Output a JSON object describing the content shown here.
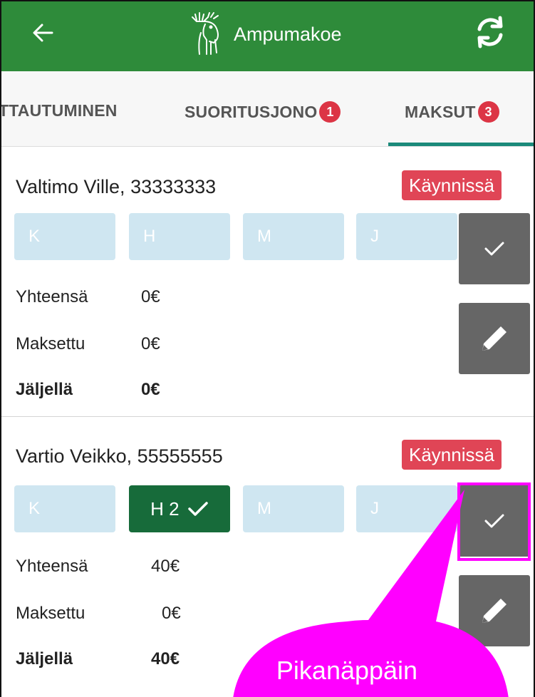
{
  "header": {
    "title": "Ampumakoe"
  },
  "tabs": [
    {
      "label": "TTAUTUMINEN"
    },
    {
      "label": "SUORITUSJONO",
      "badge": "1"
    },
    {
      "label": "MAKSUT",
      "badge": "3"
    }
  ],
  "cards": [
    {
      "name": "Valtimo Ville, 33333333",
      "status": "Käynnissä",
      "chips": [
        "K",
        "H",
        "M",
        "J"
      ],
      "rows": [
        {
          "label": "Yhteensä",
          "value": "0€"
        },
        {
          "label": "Maksettu",
          "value": "0€"
        },
        {
          "label": "Jäljellä",
          "value": "0€"
        }
      ]
    },
    {
      "name": "Vartio Veikko, 55555555",
      "status": "Käynnissä",
      "chips": [
        "K",
        "H 2",
        "M",
        "J"
      ],
      "rows": [
        {
          "label": "Yhteensä",
          "value": "40€"
        },
        {
          "label": "Maksettu",
          "value": "0€"
        },
        {
          "label": "Jäljellä",
          "value": "40€"
        }
      ]
    }
  ],
  "callout": {
    "text": "Pikanäppäin",
    "color": "#ff00ff"
  },
  "colors": {
    "appbar": "#2e8b3a",
    "status": "#e04556",
    "chip_inactive": "#cfe6f1",
    "chip_active": "#176b3a",
    "badge": "#dc3545",
    "tab_indicator": "#1b8a7a"
  },
  "icons": {
    "back": "arrow-left-icon",
    "logo": "moose-logo-icon",
    "refresh": "refresh-icon",
    "confirm": "check-icon",
    "edit": "pencil-icon"
  }
}
